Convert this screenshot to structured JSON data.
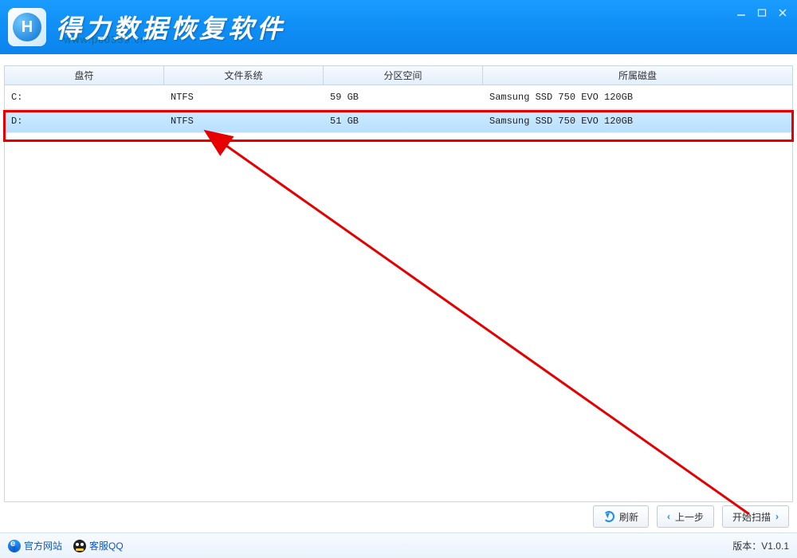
{
  "app_title": "得力数据恢复软件",
  "watermark": "www.pc0359.cn",
  "table": {
    "headers": {
      "drive": "盘符",
      "filesystem": "文件系统",
      "size": "分区空间",
      "disk": "所属磁盘"
    },
    "rows": [
      {
        "drive": "C:",
        "fs": "NTFS",
        "size": "59 GB",
        "disk": "Samsung SSD 750 EVO 120GB",
        "selected": false
      },
      {
        "drive": "D:",
        "fs": "NTFS",
        "size": "51 GB",
        "disk": "Samsung SSD 750 EVO 120GB",
        "selected": true
      }
    ]
  },
  "buttons": {
    "refresh": "刷新",
    "prev": "上一步",
    "scan": "开始扫描"
  },
  "statusbar": {
    "website": "官方网站",
    "support": "客服QQ",
    "version_label": "版本：",
    "version_value": "V1.0.1"
  },
  "colors": {
    "titlebar": "#0f8ef5",
    "highlight": "#e60000",
    "accent_blue": "#1d8fe8"
  }
}
